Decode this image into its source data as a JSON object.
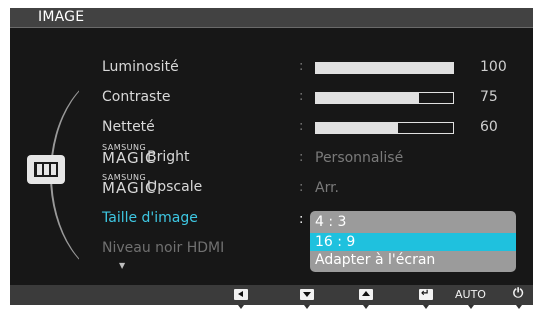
{
  "osd": {
    "title": "IMAGE",
    "category_icon": "picture-frame-icon",
    "menu": {
      "brightness": {
        "label": "Luminosité",
        "value": "100",
        "level": 1.0
      },
      "contrast": {
        "label": "Contraste",
        "value": "75",
        "level": 0.75
      },
      "sharpness": {
        "label": "Netteté",
        "value": "60",
        "level": 0.6
      },
      "magic_bright": {
        "brand_small": "SAMSUNG",
        "brand_large": "MAGIC",
        "label": "Bright",
        "value": "Personnalisé"
      },
      "magic_upscale": {
        "brand_small": "SAMSUNG",
        "brand_large": "MAGIC",
        "label": "Upscale",
        "value": "Arr."
      },
      "image_size": {
        "label": "Taille d'image",
        "colon": ":"
      },
      "hdmi_black": {
        "label": "Niveau noir HDMI"
      }
    },
    "colon": ":",
    "scroll_down_icon": "▼",
    "dropdown": {
      "options": [
        "4 : 3",
        "16 : 9",
        "Adapter à l'écran"
      ],
      "selected": "16 : 9"
    },
    "footer": {
      "auto_label": "AUTO",
      "power_glyph": "⏻",
      "enter_glyph": "↵",
      "icons": [
        "left-arrow-icon",
        "down-arrow-icon",
        "up-arrow-icon",
        "enter-icon",
        "auto-icon",
        "power-icon"
      ]
    },
    "colors": {
      "highlight": "#1fc1de",
      "selected_text": "#3ec7e2",
      "background": "#171717",
      "titlebar": "#424242"
    }
  }
}
